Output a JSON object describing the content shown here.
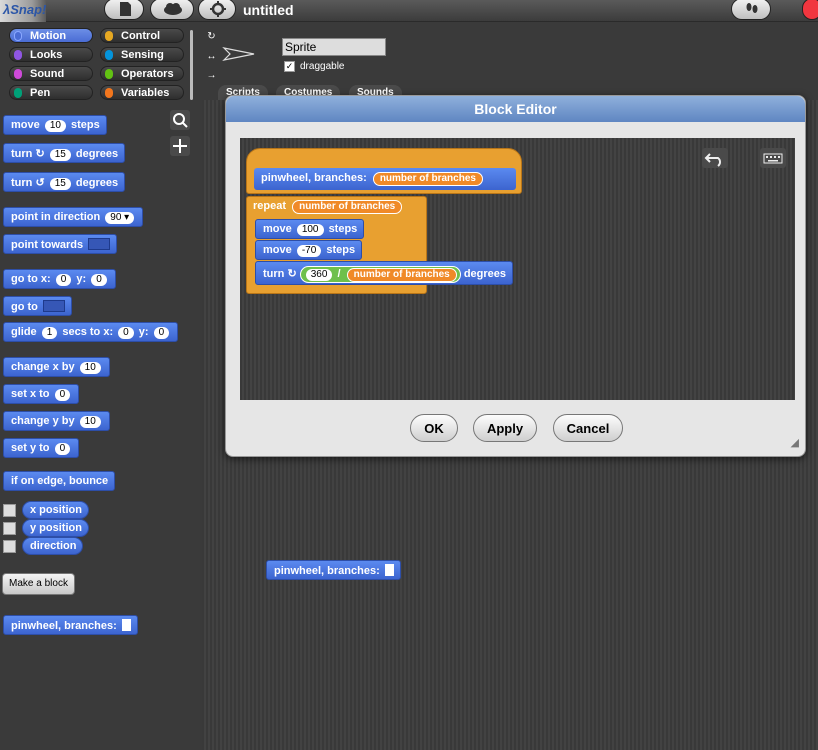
{
  "topbar": {
    "logo": "λSnap!",
    "project_title": "untitled"
  },
  "categories": [
    {
      "label": "Motion",
      "color": "#4a6cd4",
      "selected": true
    },
    {
      "label": "Control",
      "color": "#e6a822"
    },
    {
      "label": "Looks",
      "color": "#8f56e3"
    },
    {
      "label": "Sensing",
      "color": "#0494dc"
    },
    {
      "label": "Sound",
      "color": "#cf4ad9"
    },
    {
      "label": "Operators",
      "color": "#62c213"
    },
    {
      "label": "Pen",
      "color": "#00a178"
    },
    {
      "label": "Variables",
      "color": "#f3761d"
    }
  ],
  "palette": {
    "move": {
      "label": "move",
      "value": "10",
      "suffix": "steps"
    },
    "turn_cw": {
      "label": "turn",
      "value": "15",
      "suffix": "degrees"
    },
    "turn_ccw": {
      "label": "turn",
      "value": "15",
      "suffix": "degrees"
    },
    "point_in_direction": {
      "label": "point in direction",
      "value": "90"
    },
    "point_towards": {
      "label": "point towards"
    },
    "go_to_xy": {
      "label": "go to x:",
      "x": "0",
      "ylabel": "y:",
      "y": "0"
    },
    "go_to": {
      "label": "go to"
    },
    "glide": {
      "label": "glide",
      "secs": "1",
      "mid": "secs to x:",
      "x": "0",
      "ylabel": "y:",
      "y": "0"
    },
    "change_x": {
      "label": "change x by",
      "value": "10"
    },
    "set_x": {
      "label": "set x to",
      "value": "0"
    },
    "change_y": {
      "label": "change y by",
      "value": "10"
    },
    "set_y": {
      "label": "set y to",
      "value": "0"
    },
    "bounce": {
      "label": "if on edge, bounce"
    },
    "x_position": "x position",
    "y_position": "y position",
    "direction": "direction",
    "make_block": "Make a block",
    "custom_block": "pinwheel, branches:"
  },
  "sprite": {
    "name": "Sprite",
    "draggable_label": "draggable",
    "draggable_checked": "✓"
  },
  "tabs": [
    "Scripts",
    "Costumes",
    "Sounds"
  ],
  "scripts_area": {
    "custom_block": "pinwheel, branches:"
  },
  "block_editor": {
    "title": "Block Editor",
    "hat_label": "pinwheel, branches:",
    "hat_param": "number of branches",
    "repeat_label": "repeat",
    "repeat_param": "number of branches",
    "move1_label": "move",
    "move1_value": "100",
    "move1_suffix": "steps",
    "move2_label": "move",
    "move2_value": "-70",
    "move2_suffix": "steps",
    "turn_label": "turn",
    "turn_numerator": "360",
    "turn_operator": "/",
    "turn_param": "number of branches",
    "turn_suffix": "degrees",
    "ok": "OK",
    "apply": "Apply",
    "cancel": "Cancel"
  }
}
